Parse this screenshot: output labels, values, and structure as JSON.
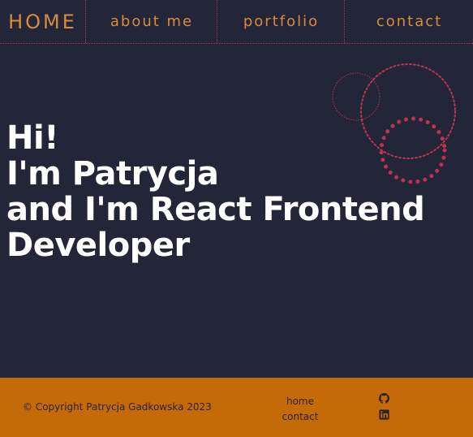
{
  "nav": {
    "home": "HOME",
    "about": "about me",
    "portfolio": "portfolio",
    "contact": "contact"
  },
  "hero": {
    "line1": "Hi!",
    "line2": "I'm Patrycja",
    "line3": "and I'm React Frontend",
    "line4": "Developer"
  },
  "footer": {
    "copyright": "© Copyright Patrycja Gadkowska 2023",
    "links": [
      "home",
      "contact"
    ],
    "icons": [
      "github-icon",
      "linkedin-icon"
    ]
  },
  "colors": {
    "background": "#222638",
    "accent": "#d98b3a",
    "decoration": "#b8354f",
    "footer": "#c46a08"
  }
}
